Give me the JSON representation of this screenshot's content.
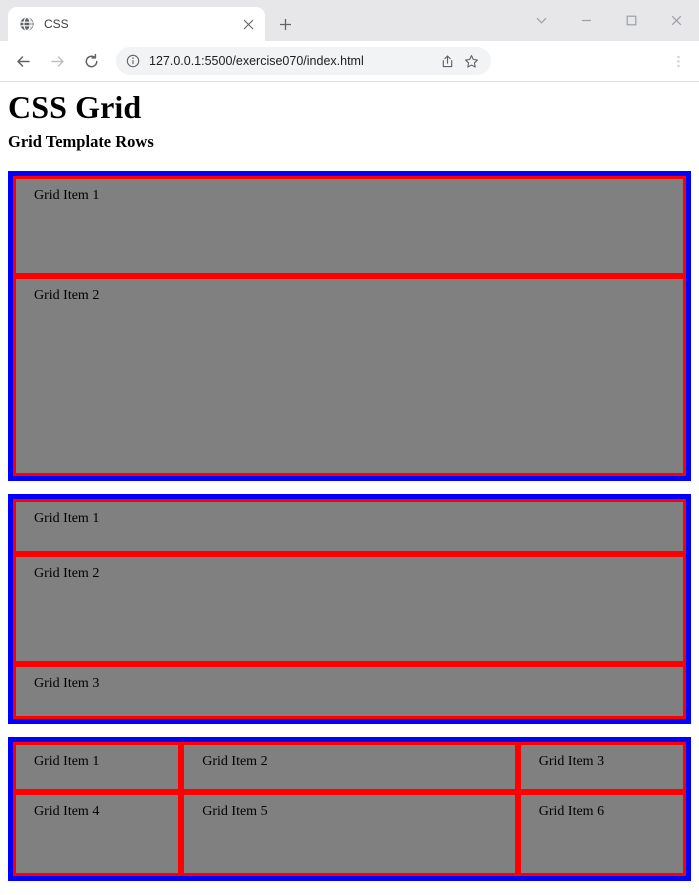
{
  "browser": {
    "tab": {
      "favicon": "globe-icon",
      "title": "CSS",
      "close_label": "×"
    },
    "new_tab_label": "+",
    "window_controls": [
      {
        "name": "tab-search",
        "glyph": "⌄"
      },
      {
        "name": "minimize",
        "glyph": "–"
      },
      {
        "name": "maximize",
        "glyph": "□"
      },
      {
        "name": "close",
        "glyph": "✕"
      }
    ],
    "toolbar": {
      "back_label": "←",
      "forward_label": "→",
      "reload_label": "↻",
      "site_info_label": "ⓘ",
      "url": "127.0.0.1:5500/exercise070/index.html",
      "share_label": "share-icon",
      "bookmark_label": "☆",
      "menu_label": "⋮"
    }
  },
  "page": {
    "heading": "CSS Grid",
    "subheading": "Grid Template Rows",
    "containers": [
      {
        "name": "grid-two-rows",
        "items": [
          {
            "label": "Grid Item 1"
          },
          {
            "label": "Grid Item 2"
          }
        ]
      },
      {
        "name": "grid-three-rows",
        "items": [
          {
            "label": "Grid Item 1"
          },
          {
            "label": "Grid Item 2"
          },
          {
            "label": "Grid Item 3"
          }
        ]
      },
      {
        "name": "grid-three-columns",
        "items": [
          {
            "label": "Grid Item 1"
          },
          {
            "label": "Grid Item 2"
          },
          {
            "label": "Grid Item 3"
          },
          {
            "label": "Grid Item 4"
          },
          {
            "label": "Grid Item 5"
          },
          {
            "label": "Grid Item 6"
          }
        ]
      }
    ]
  },
  "colors": {
    "container_border": "#0000ff",
    "item_border": "#ff0000",
    "item_background": "#808080",
    "page_background": "#ffffff",
    "tabstrip_background": "#e7e7ea"
  }
}
